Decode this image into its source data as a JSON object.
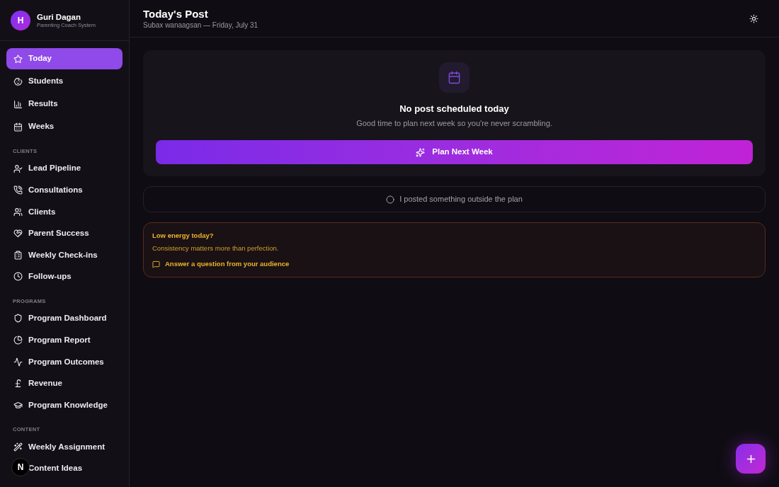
{
  "sidebar": {
    "profile": {
      "avatar_initial": "H",
      "name": "Guri Dagan",
      "subtitle": "Parenting Coach System"
    },
    "sections": [
      {
        "items": [
          {
            "label": "Today",
            "selected": true
          },
          {
            "label": "Students",
            "selected": false
          },
          {
            "label": "Results",
            "selected": false
          },
          {
            "label": "Weeks",
            "selected": false
          }
        ]
      },
      {
        "title": "CLIENTS",
        "items": [
          {
            "label": "Lead Pipeline",
            "selected": false
          },
          {
            "label": "Consultations",
            "selected": false
          },
          {
            "label": "Clients",
            "selected": false
          },
          {
            "label": "Parent Success",
            "selected": false
          },
          {
            "label": "Weekly Check-ins",
            "selected": false
          },
          {
            "label": "Follow-ups",
            "selected": false
          }
        ]
      },
      {
        "title": "PROGRAMS",
        "items": [
          {
            "label": "Program Dashboard",
            "selected": false
          },
          {
            "label": "Program Report",
            "selected": false
          },
          {
            "label": "Program Outcomes",
            "selected": false
          },
          {
            "label": "Revenue",
            "selected": false
          },
          {
            "label": "Program Knowledge",
            "selected": false
          }
        ]
      },
      {
        "title": "CONTENT",
        "items": [
          {
            "label": "Weekly Assignment",
            "selected": false
          },
          {
            "label": "Content Ideas",
            "selected": false
          }
        ]
      }
    ]
  },
  "dev_badge": "N",
  "header": {
    "title": "Today's Post",
    "subtitle": "Subax wanaagsan — Friday, July 31"
  },
  "empty_card": {
    "title": "No post scheduled today",
    "message": "Good time to plan next week so you're never scrambling.",
    "action": "Plan Next Week"
  },
  "outside_plan": {
    "label": "I posted something outside the plan",
    "checked": false
  },
  "tip": {
    "title": "Low energy today?",
    "message": "Consistency matters more than perfection.",
    "action": "Answer a question from your audience"
  }
}
